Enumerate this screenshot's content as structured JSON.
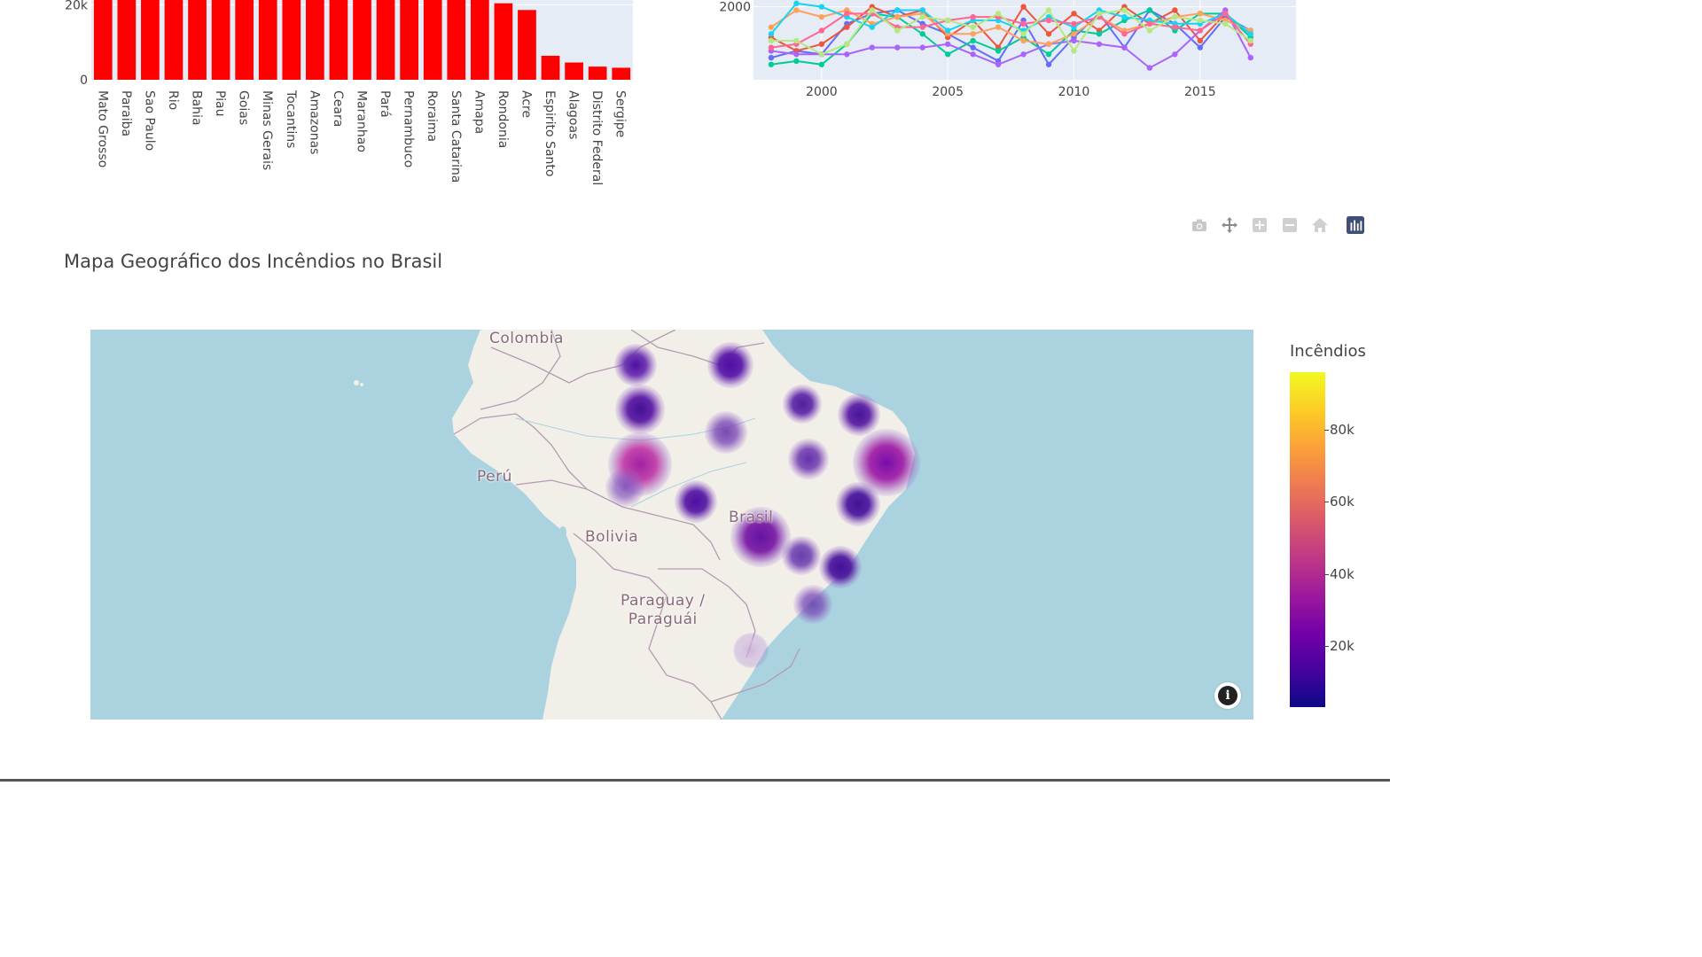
{
  "bar_chart": {
    "type": "bar",
    "color": "#ff0000",
    "categories": [
      "Mato Grosso",
      "Paraiba",
      "Sao Paulo",
      "Rio",
      "Bahia",
      "Piau",
      "Goias",
      "Minas Gerais",
      "Tocantins",
      "Amazonas",
      "Ceara",
      "Maranhao",
      "Pará",
      "Pernambuco",
      "Roraima",
      "Santa Catarina",
      "Amapa",
      "Rondonia",
      "Acre",
      "Espirito Santo",
      "Alagoas",
      "Distrito Federal",
      "Sergipe"
    ],
    "values": [
      27000,
      27000,
      27000,
      27000,
      27000,
      27000,
      27000,
      27000,
      27000,
      27000,
      27000,
      25300,
      24900,
      24800,
      24500,
      24500,
      22000,
      20400,
      18600,
      6400,
      4600,
      3500,
      3200
    ],
    "y_tick_labels": [
      "0",
      "20k"
    ],
    "y_ticks": [
      0,
      20000
    ],
    "ylim": [
      0,
      26000
    ]
  },
  "line_chart": {
    "type": "line",
    "x_tick_labels": [
      "2000",
      "2005",
      "2010",
      "2015"
    ],
    "x_ticks": [
      2000,
      2005,
      2010,
      2015
    ],
    "y_tick_labels": [
      "2000"
    ],
    "y_ticks": [
      2000
    ],
    "xlim": [
      1997.3,
      2018.8
    ],
    "ylim": [
      -150,
      2200
    ],
    "x": [
      1998,
      1999,
      2000,
      2001,
      2002,
      2003,
      2004,
      2005,
      2006,
      2007,
      2008,
      2009,
      2010,
      2011,
      2012,
      2013,
      2014,
      2015,
      2016,
      2017
    ],
    "series": [
      {
        "color": "#636efa",
        "values": [
          500,
          700,
          600,
          1500,
          1800,
          1900,
          1500,
          1200,
          800,
          400,
          1600,
          300,
          1100,
          1800,
          800,
          1900,
          1500,
          800,
          1700,
          1300
        ]
      },
      {
        "color": "#ef553b",
        "values": [
          1100,
          700,
          900,
          1400,
          2000,
          1700,
          1900,
          1100,
          1600,
          800,
          2000,
          1200,
          1800,
          1300,
          2000,
          1500,
          1900,
          1000,
          1800,
          1200
        ]
      },
      {
        "color": "#00cc96",
        "values": [
          300,
          400,
          300,
          900,
          1800,
          1700,
          1200,
          600,
          1000,
          700,
          1100,
          600,
          1300,
          1200,
          1600,
          1900,
          1300,
          1800,
          1800,
          1100
        ]
      },
      {
        "color": "#ab63fa",
        "values": [
          700,
          600,
          600,
          600,
          800,
          800,
          800,
          900,
          600,
          300,
          600,
          900,
          1000,
          900,
          800,
          200,
          600,
          1300,
          1900,
          500
        ]
      },
      {
        "color": "#ffa15a",
        "values": [
          1400,
          1900,
          1700,
          1900,
          1500,
          1700,
          1800,
          1200,
          1200,
          1400,
          1000,
          900,
          1200,
          1700,
          1300,
          1500,
          1700,
          1800,
          1600,
          1300
        ]
      },
      {
        "color": "#19d3f3",
        "values": [
          1200,
          2100,
          2000,
          1700,
          1400,
          1900,
          1900,
          1300,
          1600,
          1600,
          1300,
          1700,
          1400,
          1900,
          1700,
          1600,
          1500,
          1500,
          1800,
          1200
        ]
      },
      {
        "color": "#ff6692",
        "values": [
          800,
          900,
          1300,
          1800,
          1800,
          1400,
          1400,
          1600,
          1700,
          1700,
          1500,
          1600,
          1500,
          1700,
          1200,
          1500,
          1400,
          1300,
          1800,
          900
        ]
      },
      {
        "color": "#b6e880",
        "values": [
          1000,
          1000,
          600,
          900,
          1900,
          1300,
          1700,
          1600,
          1400,
          1800,
          1200,
          1900,
          700,
          1800,
          1900,
          1300,
          1700,
          1600,
          1500,
          1000
        ]
      }
    ]
  },
  "modebar": {
    "icons": [
      "camera-icon",
      "pan-icon",
      "zoom-in-icon",
      "zoom-out-icon",
      "reset-home-icon",
      "plotly-logo-icon"
    ]
  },
  "map": {
    "title": "Mapa Geográfico dos Incêndios no Brasil",
    "labels": {
      "colombia": "Colombia",
      "peru": "Perú",
      "bolivia": "Bolivia",
      "brasil": "Brasil",
      "paraguay_line1": "Paraguay /",
      "paraguay_line2": "Paraguái"
    },
    "colors": {
      "ocean": "#aad3df",
      "land": "#f2efe9",
      "border": "#b39cb0"
    },
    "colorbar": {
      "title": "Incêndios",
      "ticks": [
        "80k",
        "60k",
        "40k",
        "20k"
      ],
      "scale": [
        "#0d0887",
        "#46039f",
        "#7201a8",
        "#9c179e",
        "#bd3786",
        "#d8576b",
        "#ed7953",
        "#fb9f3a",
        "#fdca26",
        "#f0f921"
      ]
    }
  }
}
